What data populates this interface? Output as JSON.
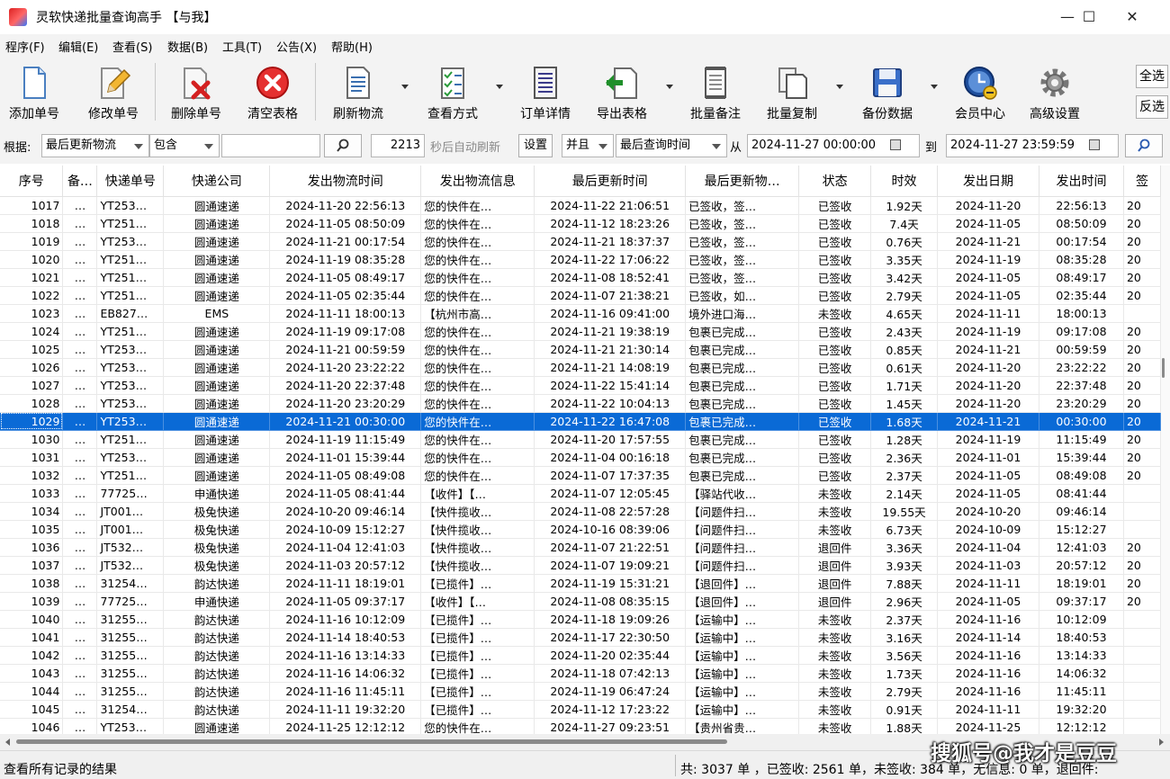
{
  "window": {
    "title": "灵软快递批量查询高手 【与我】",
    "minimize": "—",
    "maximize": "☐",
    "close": "✕"
  },
  "menu": [
    "程序(F)",
    "编辑(E)",
    "查看(S)",
    "数据(B)",
    "工具(T)",
    "公告(X)",
    "帮助(H)"
  ],
  "toolbar": {
    "add": "添加单号",
    "edit": "修改单号",
    "delete": "删除单号",
    "clear": "清空表格",
    "refresh": "刷新物流",
    "view_mode": "查看方式",
    "order_detail": "订单详情",
    "export": "导出表格",
    "batch_note": "批量备注",
    "batch_copy": "批量复制",
    "backup": "备份数据",
    "member": "会员中心",
    "advanced": "高级设置",
    "select_all": "全选",
    "invert": "反选"
  },
  "filter": {
    "basis_label": "根据:",
    "basis_value": "最后更新物流",
    "match_value": "包含",
    "keyword": "",
    "refresh_seconds": "2213",
    "auto_refresh_label": "秒后自动刷新",
    "settings": "设置",
    "logic": "并且",
    "time_field": "最后查询时间",
    "from_label": "从",
    "from": "2024-11-27 00:00:00",
    "to_label": "到",
    "to": "2024-11-27 23:59:59"
  },
  "table": {
    "columns": [
      "序号",
      "备…",
      "快递单号",
      "快递公司",
      "发出物流时间",
      "发出物流信息",
      "最后更新时间",
      "最后更新物…",
      "状态",
      "时效",
      "发出日期",
      "发出时间",
      "签"
    ],
    "selected_row_index": 12,
    "rows": [
      [
        "1017",
        "…",
        "YT253…",
        "圆通速递",
        "2024-11-20 22:56:13",
        "您的快件在…",
        "2024-11-22 21:06:51",
        "已签收，签…",
        "已签收",
        "1.92天",
        "2024-11-20",
        "22:56:13",
        "20"
      ],
      [
        "1018",
        "…",
        "YT251…",
        "圆通速递",
        "2024-11-05 08:50:09",
        "您的快件在…",
        "2024-11-12 18:23:26",
        "已签收，签…",
        "已签收",
        "7.4天",
        "2024-11-05",
        "08:50:09",
        "20"
      ],
      [
        "1019",
        "…",
        "YT253…",
        "圆通速递",
        "2024-11-21 00:17:54",
        "您的快件在…",
        "2024-11-21 18:37:37",
        "已签收，签…",
        "已签收",
        "0.76天",
        "2024-11-21",
        "00:17:54",
        "20"
      ],
      [
        "1020",
        "…",
        "YT251…",
        "圆通速递",
        "2024-11-19 08:35:28",
        "您的快件在…",
        "2024-11-22 17:06:22",
        "已签收，签…",
        "已签收",
        "3.35天",
        "2024-11-19",
        "08:35:28",
        "20"
      ],
      [
        "1021",
        "…",
        "YT251…",
        "圆通速递",
        "2024-11-05 08:49:17",
        "您的快件在…",
        "2024-11-08 18:52:41",
        "已签收，签…",
        "已签收",
        "3.42天",
        "2024-11-05",
        "08:49:17",
        "20"
      ],
      [
        "1022",
        "…",
        "YT251…",
        "圆通速递",
        "2024-11-05 02:35:44",
        "您的快件在…",
        "2024-11-07 21:38:21",
        "已签收，如…",
        "已签收",
        "2.79天",
        "2024-11-05",
        "02:35:44",
        "20"
      ],
      [
        "1023",
        "…",
        "EB827…",
        "EMS",
        "2024-11-11 18:00:13",
        "【杭州市高…",
        "2024-11-16 09:41:00",
        "境外进口海…",
        "未签收",
        "4.65天",
        "2024-11-11",
        "18:00:13",
        ""
      ],
      [
        "1024",
        "…",
        "YT251…",
        "圆通速递",
        "2024-11-19 09:17:08",
        "您的快件在…",
        "2024-11-21 19:38:19",
        "包裹已完成…",
        "已签收",
        "2.43天",
        "2024-11-19",
        "09:17:08",
        "20"
      ],
      [
        "1025",
        "…",
        "YT253…",
        "圆通速递",
        "2024-11-21 00:59:59",
        "您的快件在…",
        "2024-11-21 21:30:14",
        "包裹已完成…",
        "已签收",
        "0.85天",
        "2024-11-21",
        "00:59:59",
        "20"
      ],
      [
        "1026",
        "…",
        "YT253…",
        "圆通速递",
        "2024-11-20 23:22:22",
        "您的快件在…",
        "2024-11-21 14:08:19",
        "包裹已完成…",
        "已签收",
        "0.61天",
        "2024-11-20",
        "23:22:22",
        "20"
      ],
      [
        "1027",
        "…",
        "YT253…",
        "圆通速递",
        "2024-11-20 22:37:48",
        "您的快件在…",
        "2024-11-22 15:41:14",
        "包裹已完成…",
        "已签收",
        "1.71天",
        "2024-11-20",
        "22:37:48",
        "20"
      ],
      [
        "1028",
        "…",
        "YT253…",
        "圆通速递",
        "2024-11-20 23:20:29",
        "您的快件在…",
        "2024-11-22 10:04:13",
        "包裹已完成…",
        "已签收",
        "1.45天",
        "2024-11-20",
        "23:20:29",
        "20"
      ],
      [
        "1029",
        "…",
        "YT253…",
        "圆通速递",
        "2024-11-21 00:30:00",
        "您的快件在…",
        "2024-11-22 16:47:08",
        "包裹已完成…",
        "已签收",
        "1.68天",
        "2024-11-21",
        "00:30:00",
        "20"
      ],
      [
        "1030",
        "…",
        "YT251…",
        "圆通速递",
        "2024-11-19 11:15:49",
        "您的快件在…",
        "2024-11-20 17:57:55",
        "包裹已完成…",
        "已签收",
        "1.28天",
        "2024-11-19",
        "11:15:49",
        "20"
      ],
      [
        "1031",
        "…",
        "YT253…",
        "圆通速递",
        "2024-11-01 15:39:44",
        "您的快件在…",
        "2024-11-04 00:16:18",
        "包裹已完成…",
        "已签收",
        "2.36天",
        "2024-11-01",
        "15:39:44",
        "20"
      ],
      [
        "1032",
        "…",
        "YT251…",
        "圆通速递",
        "2024-11-05 08:49:08",
        "您的快件在…",
        "2024-11-07 17:37:35",
        "包裹已完成…",
        "已签收",
        "2.37天",
        "2024-11-05",
        "08:49:08",
        "20"
      ],
      [
        "1033",
        "…",
        "77725…",
        "申通快递",
        "2024-11-05 08:41:44",
        "【收件】【…",
        "2024-11-07 12:05:45",
        "【驿站代收…",
        "未签收",
        "2.14天",
        "2024-11-05",
        "08:41:44",
        ""
      ],
      [
        "1034",
        "…",
        "JT001…",
        "极兔快递",
        "2024-10-20 09:46:14",
        "【快件揽收…",
        "2024-11-08 22:57:28",
        "【问题件扫…",
        "未签收",
        "19.55天",
        "2024-10-20",
        "09:46:14",
        ""
      ],
      [
        "1035",
        "…",
        "JT001…",
        "极兔快递",
        "2024-10-09 15:12:27",
        "【快件揽收…",
        "2024-10-16 08:39:06",
        "【问题件扫…",
        "未签收",
        "6.73天",
        "2024-10-09",
        "15:12:27",
        ""
      ],
      [
        "1036",
        "…",
        "JT532…",
        "极兔快递",
        "2024-11-04 12:41:03",
        "【快件揽收…",
        "2024-11-07 21:22:51",
        "【问题件扫…",
        "退回件",
        "3.36天",
        "2024-11-04",
        "12:41:03",
        "20"
      ],
      [
        "1037",
        "…",
        "JT532…",
        "极兔快递",
        "2024-11-03 20:57:12",
        "【快件揽收…",
        "2024-11-07 19:09:21",
        "【问题件扫…",
        "退回件",
        "3.93天",
        "2024-11-03",
        "20:57:12",
        "20"
      ],
      [
        "1038",
        "…",
        "31254…",
        "韵达快递",
        "2024-11-11 18:19:01",
        "【已揽件】…",
        "2024-11-19 15:31:21",
        "【退回件】…",
        "退回件",
        "7.88天",
        "2024-11-11",
        "18:19:01",
        "20"
      ],
      [
        "1039",
        "…",
        "77725…",
        "申通快递",
        "2024-11-05 09:37:17",
        "【收件】【…",
        "2024-11-08 08:35:15",
        "【退回件】…",
        "退回件",
        "2.96天",
        "2024-11-05",
        "09:37:17",
        "20"
      ],
      [
        "1040",
        "…",
        "31255…",
        "韵达快递",
        "2024-11-16 10:12:09",
        "【已揽件】…",
        "2024-11-18 19:09:26",
        "【运输中】…",
        "未签收",
        "2.37天",
        "2024-11-16",
        "10:12:09",
        ""
      ],
      [
        "1041",
        "…",
        "31255…",
        "韵达快递",
        "2024-11-14 18:40:53",
        "【已揽件】…",
        "2024-11-17 22:30:50",
        "【运输中】…",
        "未签收",
        "3.16天",
        "2024-11-14",
        "18:40:53",
        ""
      ],
      [
        "1042",
        "…",
        "31255…",
        "韵达快递",
        "2024-11-16 13:14:33",
        "【已揽件】…",
        "2024-11-20 02:35:44",
        "【运输中】…",
        "未签收",
        "3.56天",
        "2024-11-16",
        "13:14:33",
        ""
      ],
      [
        "1043",
        "…",
        "31255…",
        "韵达快递",
        "2024-11-16 14:06:32",
        "【已揽件】…",
        "2024-11-18 07:42:13",
        "【运输中】…",
        "未签收",
        "1.73天",
        "2024-11-16",
        "14:06:32",
        ""
      ],
      [
        "1044",
        "…",
        "31255…",
        "韵达快递",
        "2024-11-16 11:45:11",
        "【已揽件】…",
        "2024-11-19 06:47:24",
        "【运输中】…",
        "未签收",
        "2.79天",
        "2024-11-16",
        "11:45:11",
        ""
      ],
      [
        "1045",
        "…",
        "31254…",
        "韵达快递",
        "2024-11-11 19:32:20",
        "【已揽件】…",
        "2024-11-12 17:23:22",
        "【运输中】…",
        "未签收",
        "0.91天",
        "2024-11-11",
        "19:32:20",
        ""
      ],
      [
        "1046",
        "…",
        "YT253…",
        "圆通速递",
        "2024-11-25 12:12:12",
        "您的快件在…",
        "2024-11-27 09:23:51",
        "【贵州省贵…",
        "未签收",
        "1.88天",
        "2024-11-25",
        "12:12:12",
        ""
      ]
    ]
  },
  "status": {
    "left": "查看所有记录的结果",
    "summary": "共: 3037 单 ，已签收: 2561 单，未签收: 384 单，无信息: 0 单，退回件:"
  },
  "watermark": "搜狐号@我才是豆豆"
}
